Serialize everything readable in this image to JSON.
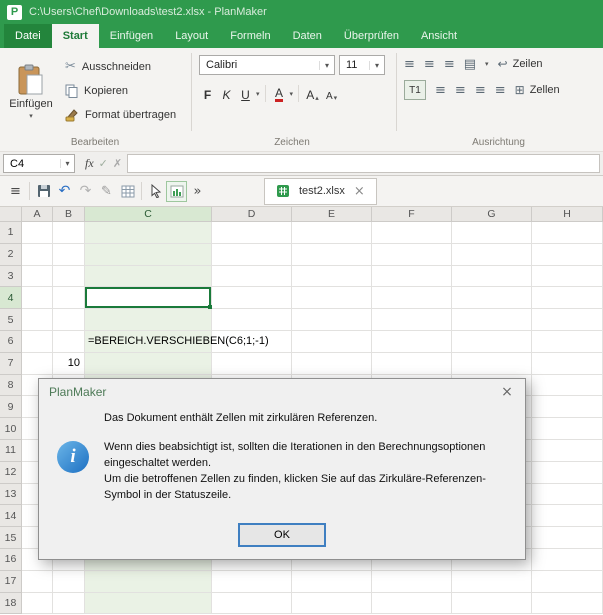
{
  "window": {
    "app_initial": "P",
    "title": "C:\\Users\\Chef\\Downloads\\test2.xlsx - PlanMaker"
  },
  "menu": {
    "tabs": [
      "Datei",
      "Start",
      "Einfügen",
      "Layout",
      "Formeln",
      "Daten",
      "Überprüfen",
      "Ansicht"
    ],
    "active_tab": "Start"
  },
  "ribbon": {
    "paste_label": "Einfügen",
    "cut_label": "Ausschneiden",
    "copy_label": "Kopieren",
    "format_painter_label": "Format übertragen",
    "group_edit": "Bearbeiten",
    "group_font": "Zeichen",
    "group_alignment": "Ausrichtung",
    "font_name": "Calibri",
    "font_size": "11",
    "bold": "F",
    "italic": "K",
    "underline": "U",
    "fontcolor": "A",
    "grow": "A",
    "shrink": "A",
    "orient": "T1",
    "wrap_label": "Zeilen",
    "merge_label": "Zellen"
  },
  "formula_bar": {
    "cell_ref": "C4",
    "fx": "fx",
    "value": ""
  },
  "toolbar": {
    "tab_label": "test2.xlsx"
  },
  "grid": {
    "columns": [
      "A",
      "B",
      "C",
      "D",
      "E",
      "F",
      "G",
      "H"
    ],
    "row_count": 18,
    "selected_cell": "C4",
    "highlight_column": "C",
    "cells": [
      {
        "ref": "C6",
        "text": "=BEREICH.VERSCHIEBEN(C6;1;-1)",
        "align": "left"
      },
      {
        "ref": "B7",
        "text": "10",
        "align": "right"
      }
    ]
  },
  "dialog": {
    "title": "PlanMaker",
    "message_main": "Das Dokument enthält Zellen mit zirkulären Referenzen.",
    "message_line2": "Wenn dies beabsichtigt ist, sollten die Iterationen in den Berechnungsoptionen eingeschaltet werden.",
    "message_line3": "Um die betroffenen Zellen zu finden, klicken Sie auf das Zirkuläre-Referenzen-Symbol in der Statuszeile.",
    "ok_label": "OK",
    "close_icon": "×"
  },
  "icons": {
    "menu": "≡",
    "undo": "↶",
    "redo": "↷",
    "pencil": "✎",
    "overflow": "»",
    "dropdown": "▾",
    "scissors": "✂",
    "check": "✓",
    "cancel": "✗",
    "align": "≡",
    "borders": "▤",
    "merge": "⊞",
    "wrap": "↩",
    "grow_arrow": "▴",
    "shrink_arrow": "▾"
  }
}
